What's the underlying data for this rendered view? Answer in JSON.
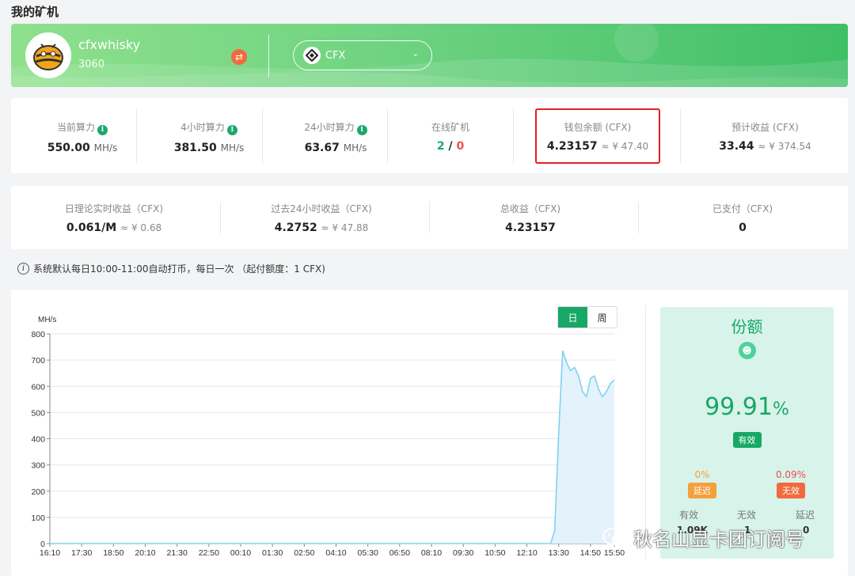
{
  "page": {
    "title": "我的矿机"
  },
  "banner": {
    "username": "cfxwhisky",
    "device": "3060",
    "coin": "CFX"
  },
  "stats": [
    {
      "label": "当前算力",
      "value": "550.00",
      "unit": "MH/s",
      "info": true
    },
    {
      "label": "4小时算力",
      "value": "381.50",
      "unit": "MH/s",
      "info": true
    },
    {
      "label": "24小时算力",
      "value": "63.67",
      "unit": "MH/s",
      "info": true
    },
    {
      "label": "在线矿机",
      "online": "2",
      "slash": "/",
      "offline": "0"
    },
    {
      "label": "钱包余额 (CFX)",
      "value": "4.23157",
      "approx": "≈ ¥ 47.40",
      "highlighted": true
    },
    {
      "label": "预计收益 (CFX)",
      "value": "33.44",
      "approx": "≈ ¥ 374.54"
    }
  ],
  "earnings": [
    {
      "label": "日理论实时收益（CFX)",
      "value": "0.061/M",
      "approx": "≈ ¥ 0.68"
    },
    {
      "label": "过去24小时收益（CFX)",
      "value": "4.2752",
      "approx": "≈ ¥  47.88"
    },
    {
      "label": "总收益（CFX)",
      "value": "4.23157"
    },
    {
      "label": "已支付（CFX)",
      "value": "0"
    }
  ],
  "notice": "系统默认每日10:00-11:00自动打币，每日一次 （起付额度：1 CFX)",
  "tabs": [
    "日",
    "周"
  ],
  "active_tab": "日",
  "chart_data": {
    "type": "area",
    "ylabel": "MH/s",
    "ylim": [
      0,
      800
    ],
    "yticks": [
      0,
      100,
      200,
      300,
      400,
      500,
      600,
      700,
      800
    ],
    "xticks": [
      "16:10",
      "17:30",
      "18:50",
      "20:10",
      "21:30",
      "22:50",
      "00:10",
      "01:30",
      "02:50",
      "04:10",
      "05:30",
      "06:50",
      "08:10",
      "09:30",
      "10:50",
      "12:10",
      "13:30",
      "14:50",
      "15:50"
    ],
    "series": [
      {
        "x": [
          "16:10",
          "13:10",
          "13:20",
          "13:30",
          "13:40",
          "13:50",
          "14:00",
          "14:10",
          "14:20",
          "14:30",
          "14:40",
          "14:50",
          "15:00",
          "15:10",
          "15:20",
          "15:30",
          "15:40",
          "15:50"
        ],
        "values": [
          0,
          0,
          50,
          420,
          735,
          690,
          660,
          672,
          640,
          580,
          560,
          630,
          640,
          590,
          560,
          580,
          610,
          625
        ]
      }
    ],
    "color": "#7fd3f0",
    "fill": "#e3f2fb"
  },
  "share": {
    "title": "份额",
    "percent": "99.91",
    "percent_sign": "%",
    "valid_badge": "有效",
    "delay_pct": "0%",
    "delay_badge": "延迟",
    "invalid_pct": "0.09%",
    "invalid_badge": "无效",
    "footer_labels": [
      "有效",
      "无效",
      "延迟"
    ],
    "footer_values": [
      "1.09K",
      "1",
      "0"
    ]
  },
  "watermark": "秋名山显卡团订阅号",
  "colors": {
    "accent": "#17a866",
    "danger": "#e8504d",
    "highlight_box": "#e02020"
  }
}
